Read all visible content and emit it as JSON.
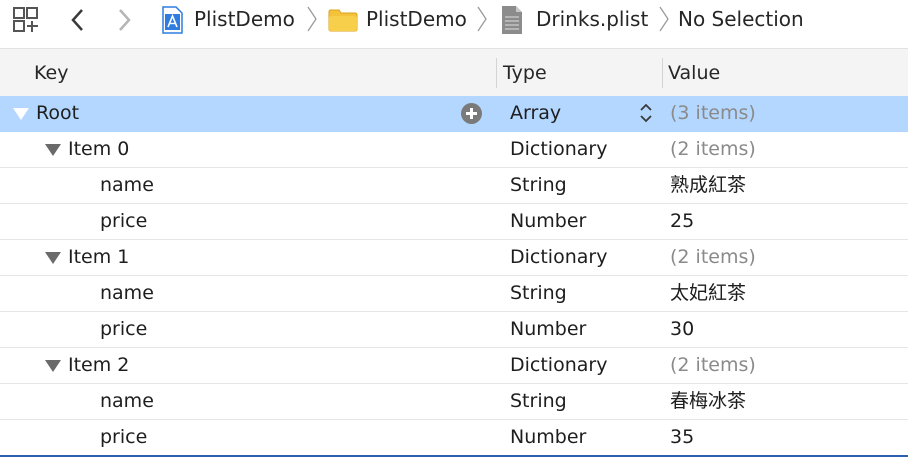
{
  "jumpbar": {
    "project": "PlistDemo",
    "group": "PlistDemo",
    "file": "Drinks.plist",
    "selection": "No Selection",
    "icons": [
      "related-items-grid-icon",
      "back-arrow-icon",
      "forward-arrow-icon",
      "xcode-project-icon",
      "folder-icon",
      "plist-file-icon"
    ]
  },
  "columns": {
    "key": "Key",
    "type": "Type",
    "value": "Value"
  },
  "rows": [
    {
      "key": "Root",
      "type": "Array",
      "value": "(3 items)",
      "level": 0,
      "expandable": true,
      "selected": true,
      "muted": true
    },
    {
      "key": "Item 0",
      "type": "Dictionary",
      "value": "(2 items)",
      "level": 1,
      "expandable": true,
      "muted": true
    },
    {
      "key": "name",
      "type": "String",
      "value": "熟成紅茶",
      "level": 2
    },
    {
      "key": "price",
      "type": "Number",
      "value": "25",
      "level": 2
    },
    {
      "key": "Item 1",
      "type": "Dictionary",
      "value": "(2 items)",
      "level": 1,
      "expandable": true,
      "muted": true
    },
    {
      "key": "name",
      "type": "String",
      "value": "太妃紅茶",
      "level": 2
    },
    {
      "key": "price",
      "type": "Number",
      "value": "30",
      "level": 2
    },
    {
      "key": "Item 2",
      "type": "Dictionary",
      "value": "(2 items)",
      "level": 1,
      "expandable": true,
      "muted": true
    },
    {
      "key": "name",
      "type": "String",
      "value": "春梅冰茶",
      "level": 2
    },
    {
      "key": "price",
      "type": "Number",
      "value": "35",
      "level": 2
    }
  ],
  "colors": {
    "selection": "#b3d7ff",
    "muted_text": "#8a8a8a",
    "folder": "#f5c33b",
    "project_icon": "#2f7de1"
  }
}
